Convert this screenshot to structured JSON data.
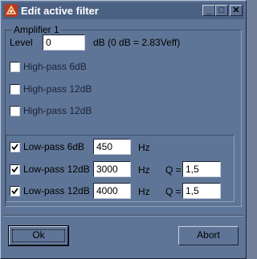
{
  "window": {
    "title": "Edit active filter",
    "controls": {
      "minimize": "_",
      "maximize": "□",
      "close": "✕"
    }
  },
  "group": {
    "legend": "Amplifier 1",
    "level": {
      "label": "Level",
      "value": "0",
      "unit": "dB (0 dB = 2.83Veff)"
    }
  },
  "filters": {
    "hp1": {
      "label": "High-pass 6dB",
      "checked": false
    },
    "hp2": {
      "label": "High-pass 12dB",
      "checked": false
    },
    "hp3": {
      "label": "High-pass 12dB",
      "checked": false
    },
    "lp1": {
      "label": "Low-pass 6dB",
      "checked": true,
      "freq": "450",
      "unit": "Hz"
    },
    "lp2": {
      "label": "Low-pass 12dB",
      "checked": true,
      "freq": "3000",
      "unit": "Hz",
      "q_label": "Q =",
      "q": "1,5"
    },
    "lp3": {
      "label": "Low-pass 12dB",
      "checked": true,
      "freq": "4000",
      "unit": "Hz",
      "q_label": "Q =",
      "q": "1,5"
    }
  },
  "buttons": {
    "ok": "Ok",
    "abort": "Abort"
  },
  "colors": {
    "face": "#5f7597",
    "titlebar": "#4a6184",
    "icon": "#b83a1f"
  }
}
